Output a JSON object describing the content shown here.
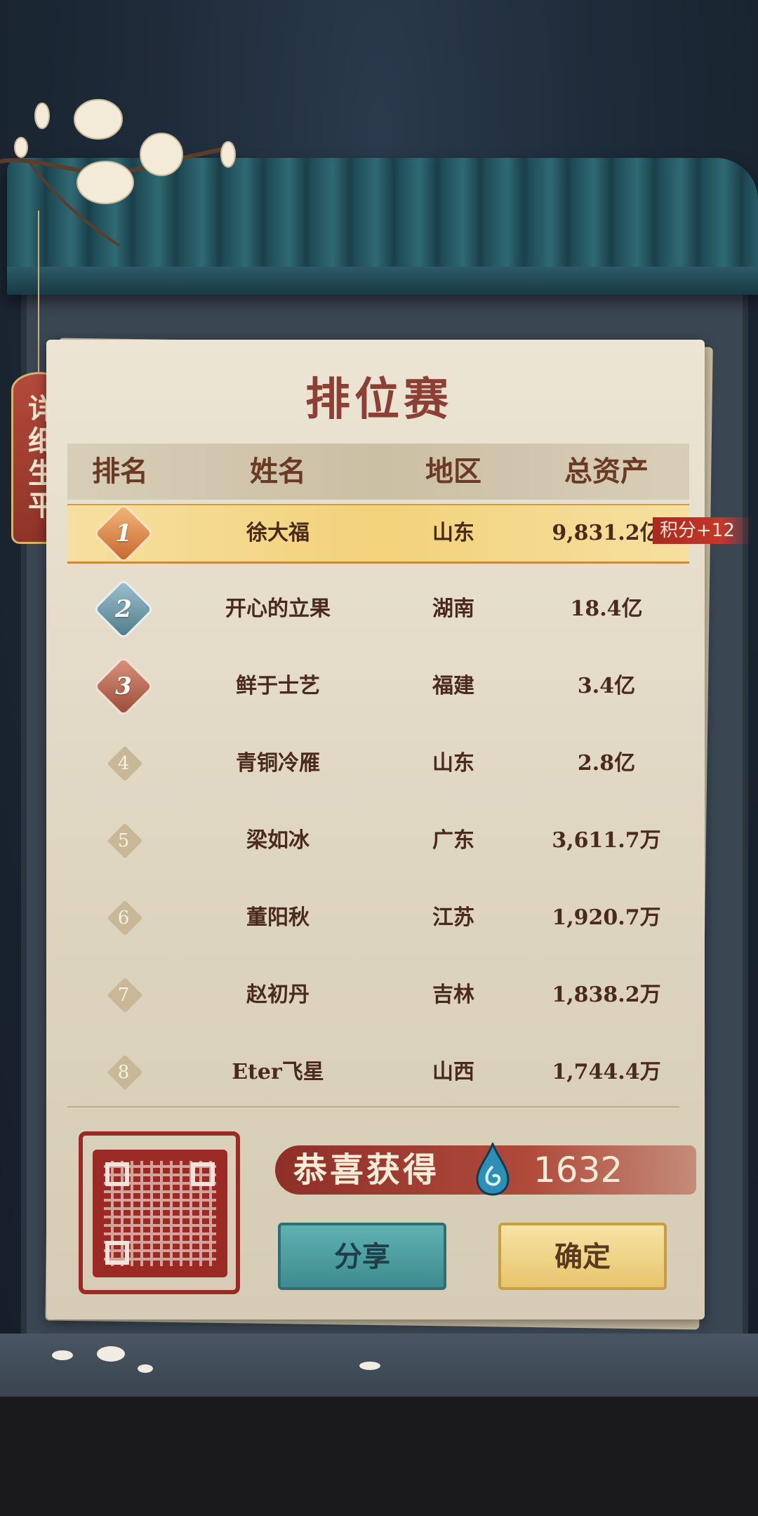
{
  "side_tag": {
    "label": "详细生平"
  },
  "title": "排位赛",
  "table": {
    "headers": {
      "rank": "排名",
      "name": "姓名",
      "region": "地区",
      "assets": "总资产"
    },
    "rows": [
      {
        "rank": "1",
        "name": "徐大福",
        "region": "山东",
        "assets": "9,831.2亿",
        "highlight": true
      },
      {
        "rank": "2",
        "name": "开心的立果",
        "region": "湖南",
        "assets": "18.4亿"
      },
      {
        "rank": "3",
        "name": "鲜于士艺",
        "region": "福建",
        "assets": "3.4亿"
      },
      {
        "rank": "4",
        "name": "青铜冷雁",
        "region": "山东",
        "assets": "2.8亿"
      },
      {
        "rank": "5",
        "name": "梁如冰",
        "region": "广东",
        "assets": "3,611.7万"
      },
      {
        "rank": "6",
        "name": "董阳秋",
        "region": "江苏",
        "assets": "1,920.7万"
      },
      {
        "rank": "7",
        "name": "赵初丹",
        "region": "吉林",
        "assets": "1,838.2万"
      },
      {
        "rank": "8",
        "name": "Eter飞星",
        "region": "山西",
        "assets": "1,744.4万"
      }
    ]
  },
  "score_badge": "积分+12",
  "reward": {
    "label": "恭喜获得",
    "value": "1632",
    "icon": "water-drop-icon"
  },
  "buttons": {
    "share": "分享",
    "confirm": "确定"
  },
  "colors": {
    "accent_red": "#8e3f35",
    "highlight_gold": "#f2d27a",
    "share_teal": "#4a9ea0",
    "confirm_gold": "#efd48a"
  }
}
